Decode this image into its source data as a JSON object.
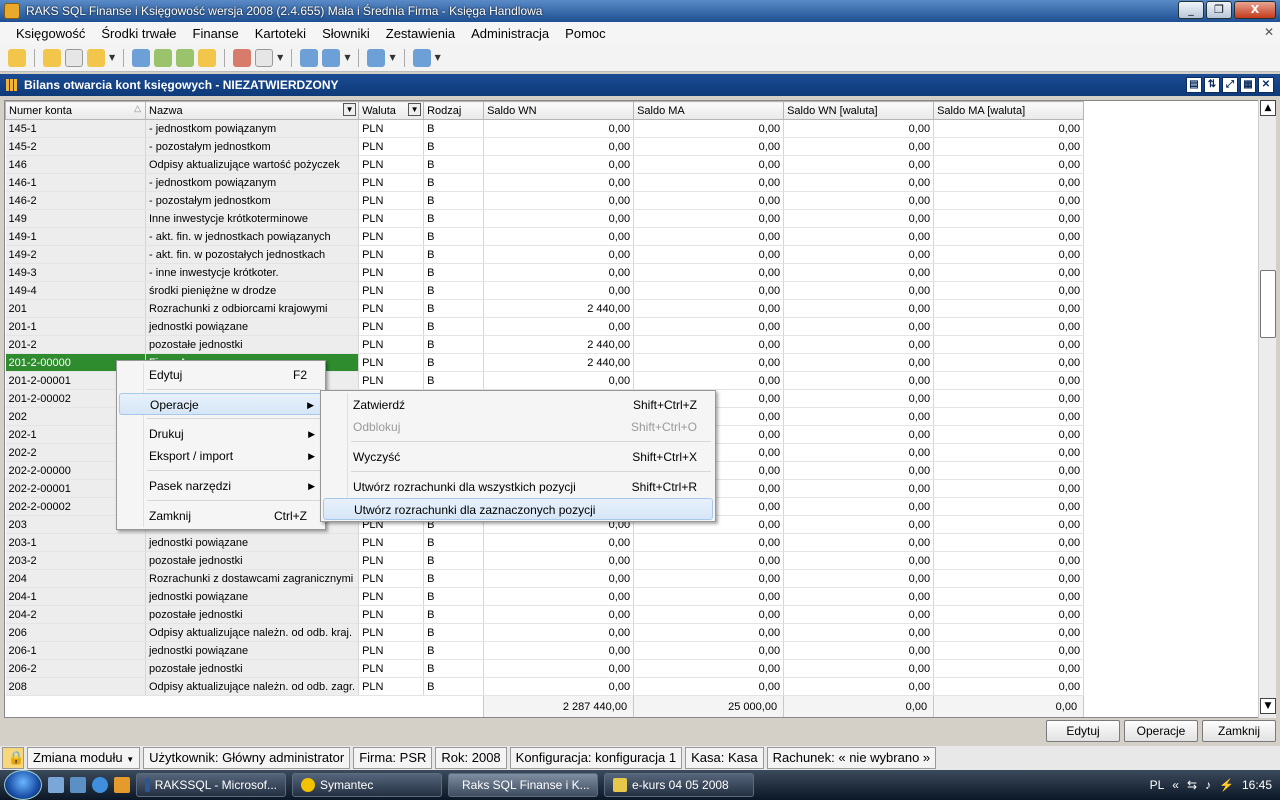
{
  "window": {
    "title": "RAKS SQL Finanse i Księgowość wersja 2008 (2.4.655) Mała i Średnia Firma - Księga Handlowa",
    "controls": {
      "minimize": "_",
      "restore": "❐",
      "close": "X"
    }
  },
  "menubar": {
    "items": [
      "Księgowość",
      "Środki trwałe",
      "Finanse",
      "Kartoteki",
      "Słowniki",
      "Zestawienia",
      "Administracja",
      "Pomoc"
    ]
  },
  "child_window": {
    "title": "Bilans otwarcia kont księgowych - NIEZATWIERDZONY"
  },
  "grid": {
    "columns": [
      "Numer konta",
      "Nazwa",
      "Waluta",
      "Rodzaj",
      "Saldo WN",
      "Saldo MA",
      "Saldo WN [waluta]",
      "Saldo MA [waluta]"
    ],
    "rows": [
      [
        "145-1",
        "- jednostkom powiązanym",
        "PLN",
        "B",
        "0,00",
        "0,00",
        "0,00",
        "0,00"
      ],
      [
        "145-2",
        "- pozostałym jednostkom",
        "PLN",
        "B",
        "0,00",
        "0,00",
        "0,00",
        "0,00"
      ],
      [
        "146",
        "Odpisy aktualizujące wartość pożyczek",
        "PLN",
        "B",
        "0,00",
        "0,00",
        "0,00",
        "0,00"
      ],
      [
        "146-1",
        "- jednostkom powiązanym",
        "PLN",
        "B",
        "0,00",
        "0,00",
        "0,00",
        "0,00"
      ],
      [
        "146-2",
        "- pozostałym jednostkom",
        "PLN",
        "B",
        "0,00",
        "0,00",
        "0,00",
        "0,00"
      ],
      [
        "149",
        "Inne inwestycje krótkoterminowe",
        "PLN",
        "B",
        "0,00",
        "0,00",
        "0,00",
        "0,00"
      ],
      [
        "149-1",
        "- akt. fin. w jednostkach powiązanych",
        "PLN",
        "B",
        "0,00",
        "0,00",
        "0,00",
        "0,00"
      ],
      [
        "149-2",
        "- akt. fin. w pozostałych jednostkach",
        "PLN",
        "B",
        "0,00",
        "0,00",
        "0,00",
        "0,00"
      ],
      [
        "149-3",
        "- inne inwestycje krótkoter.",
        "PLN",
        "B",
        "0,00",
        "0,00",
        "0,00",
        "0,00"
      ],
      [
        "149-4",
        "środki pieniężne w drodze",
        "PLN",
        "B",
        "0,00",
        "0,00",
        "0,00",
        "0,00"
      ],
      [
        "201",
        "Rozrachunki z odbiorcami krajowymi",
        "PLN",
        "B",
        "2 440,00",
        "0,00",
        "0,00",
        "0,00"
      ],
      [
        "201-1",
        "jednostki powiązane",
        "PLN",
        "B",
        "0,00",
        "0,00",
        "0,00",
        "0,00"
      ],
      [
        "201-2",
        "pozostałe jednostki",
        "PLN",
        "B",
        "2 440,00",
        "0,00",
        "0,00",
        "0,00"
      ],
      [
        "201-2-00000",
        "Firma A",
        "PLN",
        "B",
        "2 440,00",
        "0,00",
        "0,00",
        "0,00"
      ],
      [
        "201-2-00001",
        "",
        "PLN",
        "B",
        "0,00",
        "0,00",
        "0,00",
        "0,00"
      ],
      [
        "201-2-00002",
        "",
        "",
        "",
        "",
        "0,00",
        "0,00",
        "0,00"
      ],
      [
        "202",
        "",
        "",
        "",
        "",
        "0,00",
        "0,00",
        "0,00"
      ],
      [
        "202-1",
        "",
        "",
        "",
        "",
        "0,00",
        "0,00",
        "0,00"
      ],
      [
        "202-2",
        "",
        "",
        "",
        "",
        "0,00",
        "0,00",
        "0,00"
      ],
      [
        "202-2-00000",
        "",
        "",
        "",
        "",
        "0,00",
        "0,00",
        "0,00"
      ],
      [
        "202-2-00001",
        "",
        "",
        "",
        "",
        "0,00",
        "0,00",
        "0,00"
      ],
      [
        "202-2-00002",
        "",
        "",
        "",
        "",
        "0,00",
        "0,00",
        "0,00"
      ],
      [
        "203",
        "",
        "PLN",
        "B",
        "0,00",
        "0,00",
        "0,00",
        "0,00"
      ],
      [
        "203-1",
        "jednostki powiązane",
        "PLN",
        "B",
        "0,00",
        "0,00",
        "0,00",
        "0,00"
      ],
      [
        "203-2",
        "pozostałe jednostki",
        "PLN",
        "B",
        "0,00",
        "0,00",
        "0,00",
        "0,00"
      ],
      [
        "204",
        "Rozrachunki z dostawcami zagranicznymi",
        "PLN",
        "B",
        "0,00",
        "0,00",
        "0,00",
        "0,00"
      ],
      [
        "204-1",
        "jednostki powiązane",
        "PLN",
        "B",
        "0,00",
        "0,00",
        "0,00",
        "0,00"
      ],
      [
        "204-2",
        "pozostałe jednostki",
        "PLN",
        "B",
        "0,00",
        "0,00",
        "0,00",
        "0,00"
      ],
      [
        "206",
        "Odpisy aktualizujące należn. od odb. kraj.",
        "PLN",
        "B",
        "0,00",
        "0,00",
        "0,00",
        "0,00"
      ],
      [
        "206-1",
        "jednostki powiązane",
        "PLN",
        "B",
        "0,00",
        "0,00",
        "0,00",
        "0,00"
      ],
      [
        "206-2",
        "pozostałe jednostki",
        "PLN",
        "B",
        "0,00",
        "0,00",
        "0,00",
        "0,00"
      ],
      [
        "208",
        "Odpisy aktualizujące należn. od odb. zagr.",
        "PLN",
        "B",
        "0,00",
        "0,00",
        "0,00",
        "0,00"
      ]
    ],
    "selected_row": 13,
    "totals": [
      "2 287 440,00",
      "25 000,00",
      "0,00",
      "0,00"
    ]
  },
  "buttons": {
    "edit": "Edytuj",
    "operations": "Operacje",
    "close": "Zamknij"
  },
  "context_menu": {
    "items": [
      {
        "label": "Edytuj",
        "shortcut": "F2"
      },
      {
        "label": "Operacje",
        "submenu": true
      },
      {
        "label": "Drukuj",
        "submenu": true
      },
      {
        "label": "Eksport / import",
        "submenu": true
      },
      {
        "label": "Pasek narzędzi",
        "submenu": true
      },
      {
        "label": "Zamknij",
        "shortcut": "Ctrl+Z"
      }
    ],
    "submenu_arrow": "▶"
  },
  "submenu": {
    "items": [
      {
        "label": "Zatwierdź",
        "shortcut": "Shift+Ctrl+Z"
      },
      {
        "label": "Odblokuj",
        "shortcut": "Shift+Ctrl+O",
        "disabled": true
      },
      {
        "label": "Wyczyść",
        "shortcut": "Shift+Ctrl+X"
      },
      {
        "label": "Utwórz rozrachunki dla wszystkich pozycji",
        "shortcut": "Shift+Ctrl+R"
      },
      {
        "label": "Utwórz rozrachunki dla zaznaczonych pozycji",
        "shortcut": ""
      }
    ]
  },
  "statusbar": {
    "module": "Zmiana modułu",
    "user": "Użytkownik: Główny administrator",
    "company": "Firma: PSR",
    "year": "Rok: 2008",
    "config": "Konfiguracja: konfiguracja 1",
    "cashbox": "Kasa: Kasa",
    "account": "Rachunek: « nie wybrano »"
  },
  "taskbar": {
    "tasks": [
      "RAKSSQL - Microsof...",
      "Symantec",
      "Raks SQL Finanse i K...",
      "e-kurs 04 05 2008"
    ],
    "active_task": 2,
    "language": "PL",
    "clock": "16:45"
  }
}
